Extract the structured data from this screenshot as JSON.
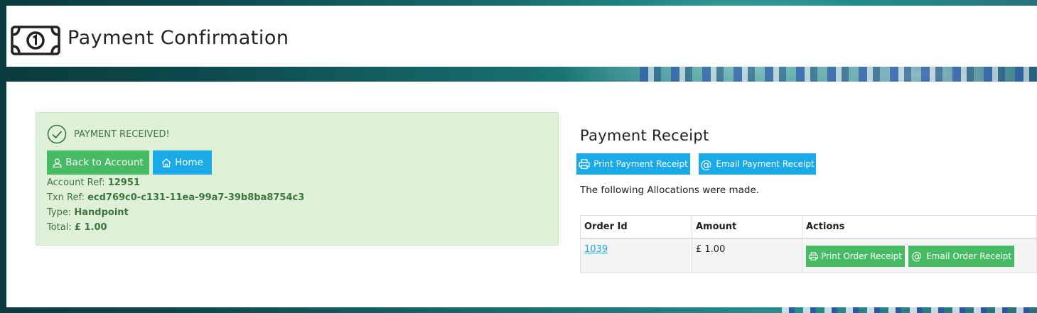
{
  "header": {
    "title": "Payment Confirmation",
    "icon": "money-note-icon"
  },
  "alert": {
    "heading": "PAYMENT RECEIVED!",
    "icon": "check-circle-icon",
    "buttons": {
      "back_label": "Back to Account",
      "home_label": "Home"
    },
    "details": {
      "account_ref_label": "Account Ref:",
      "account_ref_value": "12951",
      "txn_ref_label": "Txn Ref:",
      "txn_ref_value": "ecd769c0-c131-11ea-99a7-39b8ba8754c3",
      "type_label": "Type:",
      "type_value": "Handpoint",
      "total_label": "Total:",
      "total_value": "£ 1.00"
    }
  },
  "receipt": {
    "title": "Payment Receipt",
    "print_label": "Print Payment Receipt",
    "email_label": "Email Payment Receipt",
    "allocations_text": "The following Allocations were made.",
    "table": {
      "headers": [
        "Order Id",
        "Amount",
        "Actions"
      ],
      "rows": [
        {
          "order_id": "1039",
          "amount": "£ 1.00",
          "print_label": "Print Order Receipt",
          "email_label": "Email Order Receipt"
        }
      ]
    }
  },
  "colors": {
    "success_green": "#47bb64",
    "info_blue": "#1aaae8",
    "alert_bg": "#dff0d8",
    "alert_text": "#3c763d"
  }
}
